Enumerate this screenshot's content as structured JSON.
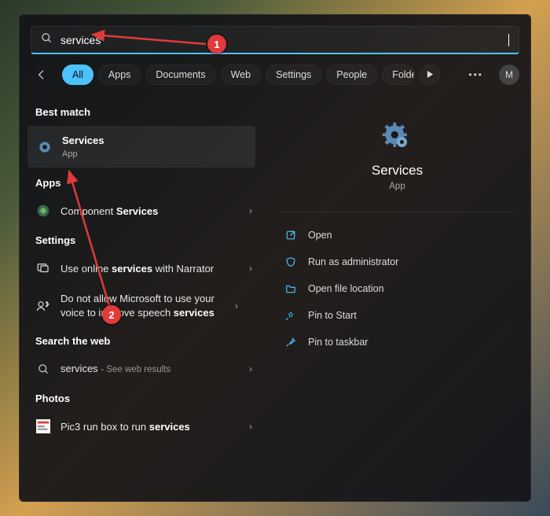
{
  "search": {
    "value": "services"
  },
  "filters": {
    "tabs": [
      "All",
      "Apps",
      "Documents",
      "Web",
      "Settings",
      "People",
      "Folders"
    ],
    "selected": 0,
    "avatar_initial": "M"
  },
  "left": {
    "best_match_heading": "Best match",
    "best_match": {
      "title": "Services",
      "subtitle": "App"
    },
    "apps_heading": "Apps",
    "apps": [
      {
        "prefix": "Component ",
        "bold": "Services"
      }
    ],
    "settings_heading": "Settings",
    "settings": [
      {
        "pre": "Use online ",
        "bold": "services",
        "post": " with Narrator",
        "multiline": false
      },
      {
        "pre": "Do not allow Microsoft to use your voice to improve speech ",
        "bold": "services",
        "post": "",
        "multiline": true
      }
    ],
    "web_heading": "Search the web",
    "web": {
      "term": "services",
      "suffix": "See web results"
    },
    "photos_heading": "Photos",
    "photos": [
      {
        "pre": "Pic3 run box to run ",
        "bold": "services"
      }
    ]
  },
  "preview": {
    "title": "Services",
    "subtitle": "App",
    "actions": [
      "Open",
      "Run as administrator",
      "Open file location",
      "Pin to Start",
      "Pin to taskbar"
    ]
  },
  "annotations": {
    "badge1": "1",
    "badge2": "2"
  }
}
